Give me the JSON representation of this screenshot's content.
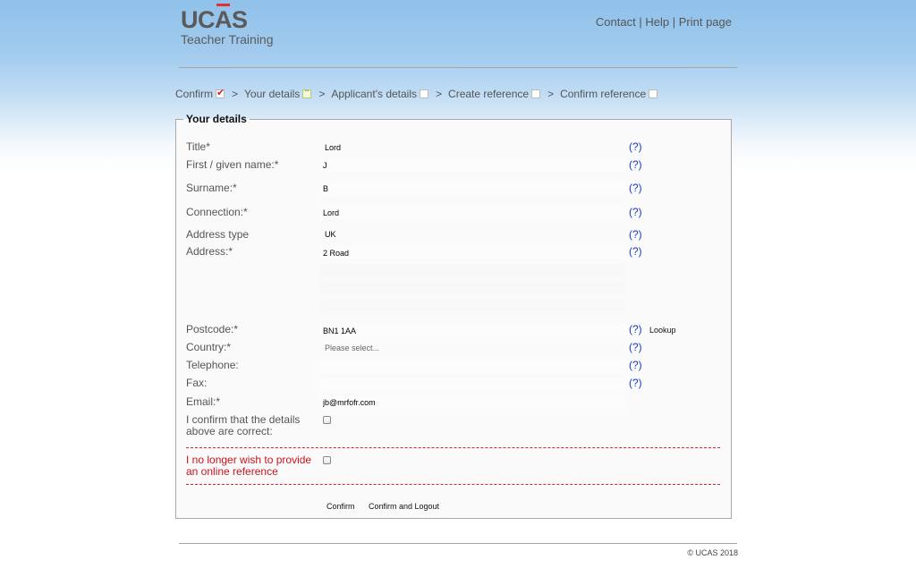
{
  "logo": {
    "brand_pre": "UC",
    "brand_accent": "A",
    "brand_post": "S",
    "subtitle": "Teacher Training"
  },
  "header": {
    "links": [
      "Contact",
      "Help",
      "Print page"
    ],
    "separator": "|"
  },
  "breadcrumb": {
    "separator": ">",
    "steps": [
      {
        "label": "Confirm",
        "status": "done"
      },
      {
        "label": "Your details",
        "status": "current"
      },
      {
        "label": "Applicant's details",
        "status": "pending"
      },
      {
        "label": "Create reference",
        "status": "pending"
      },
      {
        "label": "Confirm reference",
        "status": "pending"
      }
    ]
  },
  "form": {
    "title": "Your details",
    "help": "(?)",
    "fields": {
      "title": {
        "label": "Title*",
        "value": "Lord"
      },
      "first_name": {
        "label": "First / given name:*",
        "value": "J"
      },
      "surname": {
        "label": "Surname:*",
        "value": "B"
      },
      "connection": {
        "label": "Connection:*",
        "value": "Lord"
      },
      "address_type": {
        "label": "Address type",
        "value": "UK"
      },
      "address": {
        "label": "Address:*",
        "lines": [
          "2 Road",
          "",
          "",
          ""
        ]
      },
      "postcode": {
        "label": "Postcode:*",
        "value": "BN1 1AA",
        "lookup": "Lookup"
      },
      "country": {
        "label": "Country:*",
        "value": "Please select..."
      },
      "telephone": {
        "label": "Telephone:",
        "value": ""
      },
      "fax": {
        "label": "Fax:",
        "value": ""
      },
      "email": {
        "label": "Email:*",
        "value": "jb@mrfofr.com"
      }
    },
    "confirm_label": "I confirm that the details above are correct:",
    "confirm_checked": false,
    "decline_label": "I no longer wish to provide an online reference",
    "decline_checked": false,
    "buttons": {
      "confirm": "Confirm",
      "confirm_logout": "Confirm and Logout"
    }
  },
  "footer": {
    "copyright": "© UCAS 2018"
  },
  "colors": {
    "accent_red": "#d0262b",
    "help_link": "#1a3cc6",
    "decline_text": "#c8141c"
  }
}
